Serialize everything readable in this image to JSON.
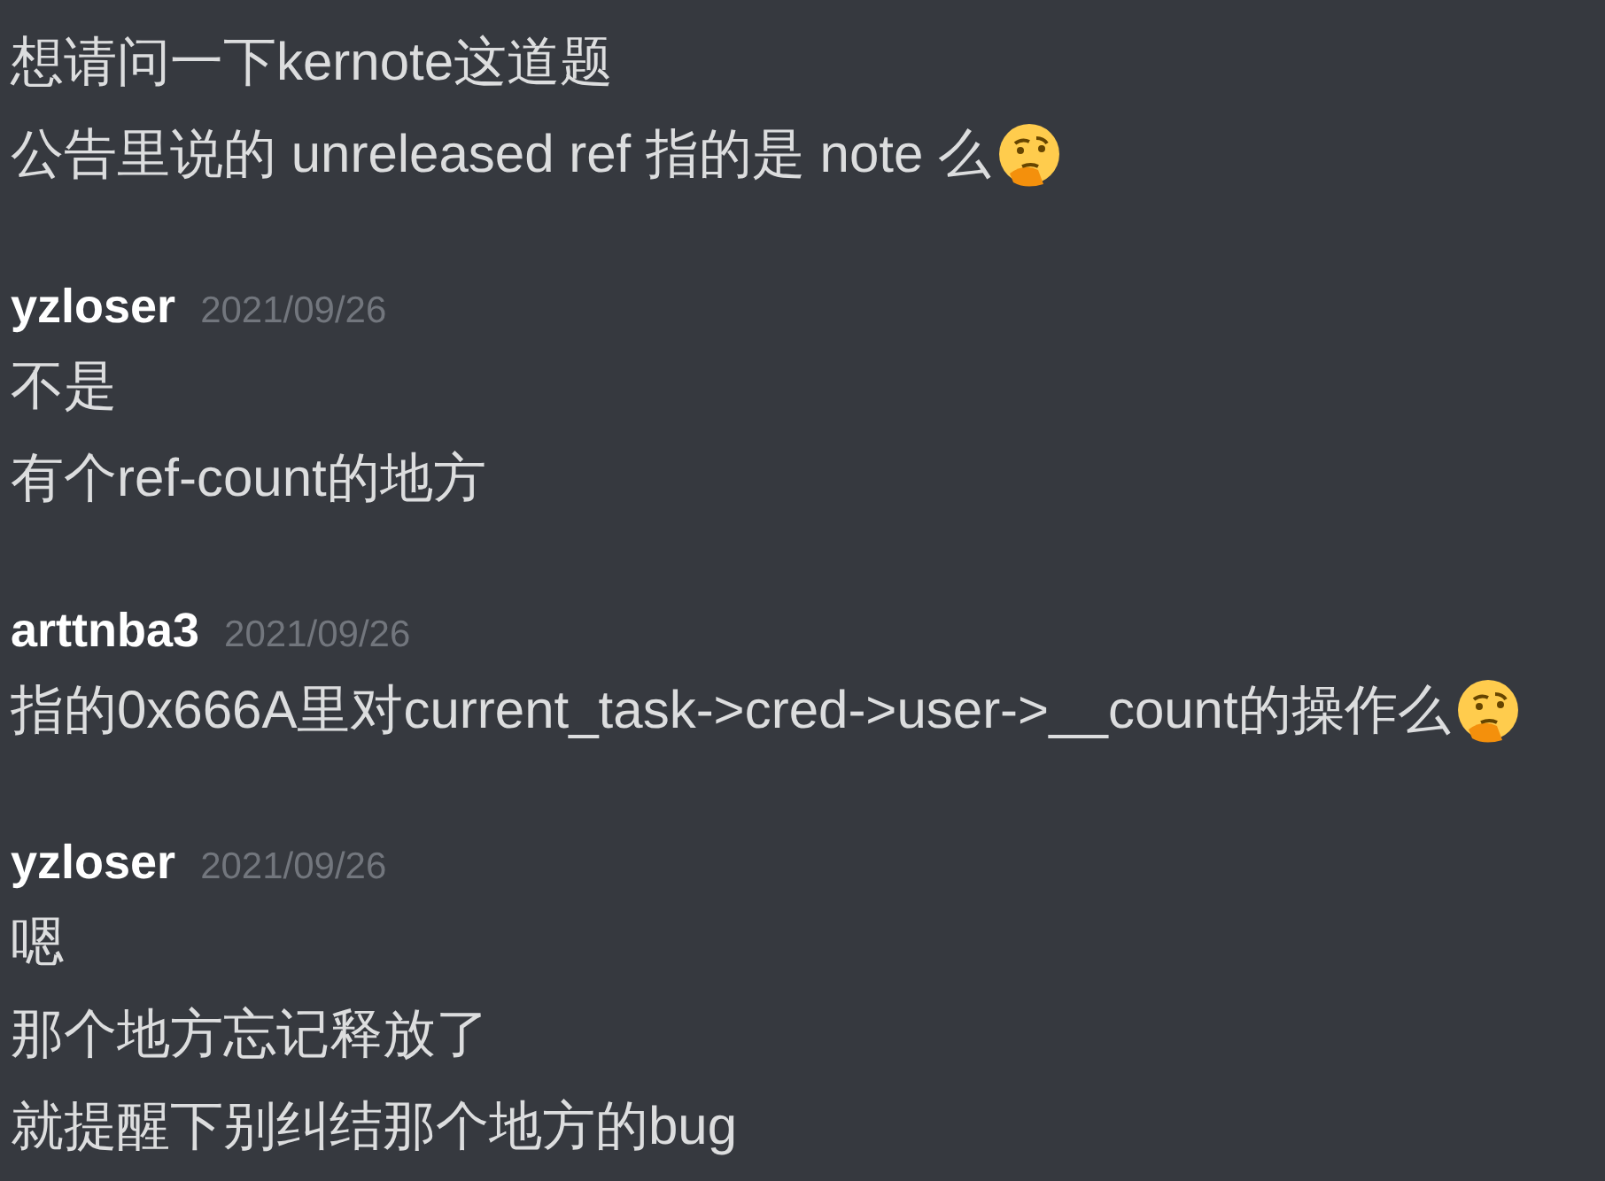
{
  "messages": [
    {
      "lines": [
        {
          "text": "想请问一下kernote这道题",
          "thinking_emoji": false
        },
        {
          "text": "公告里说的 unreleased ref 指的是 note 么",
          "thinking_emoji": true
        }
      ]
    },
    {
      "author": "yzloser",
      "timestamp": "2021/09/26",
      "lines": [
        {
          "text": "不是",
          "thinking_emoji": false
        },
        {
          "text": "有个ref-count的地方",
          "thinking_emoji": false
        }
      ]
    },
    {
      "author": "arttnba3",
      "timestamp": "2021/09/26",
      "lines": [
        {
          "text": "指的0x666A里对current_task->cred->user->__count的操作么",
          "thinking_emoji": true
        }
      ]
    },
    {
      "author": "yzloser",
      "timestamp": "2021/09/26",
      "lines": [
        {
          "text": "嗯",
          "thinking_emoji": false
        },
        {
          "text": "那个地方忘记释放了",
          "thinking_emoji": false
        },
        {
          "text": "就提醒下别纠结那个地方的bug",
          "thinking_emoji": false
        }
      ]
    }
  ]
}
